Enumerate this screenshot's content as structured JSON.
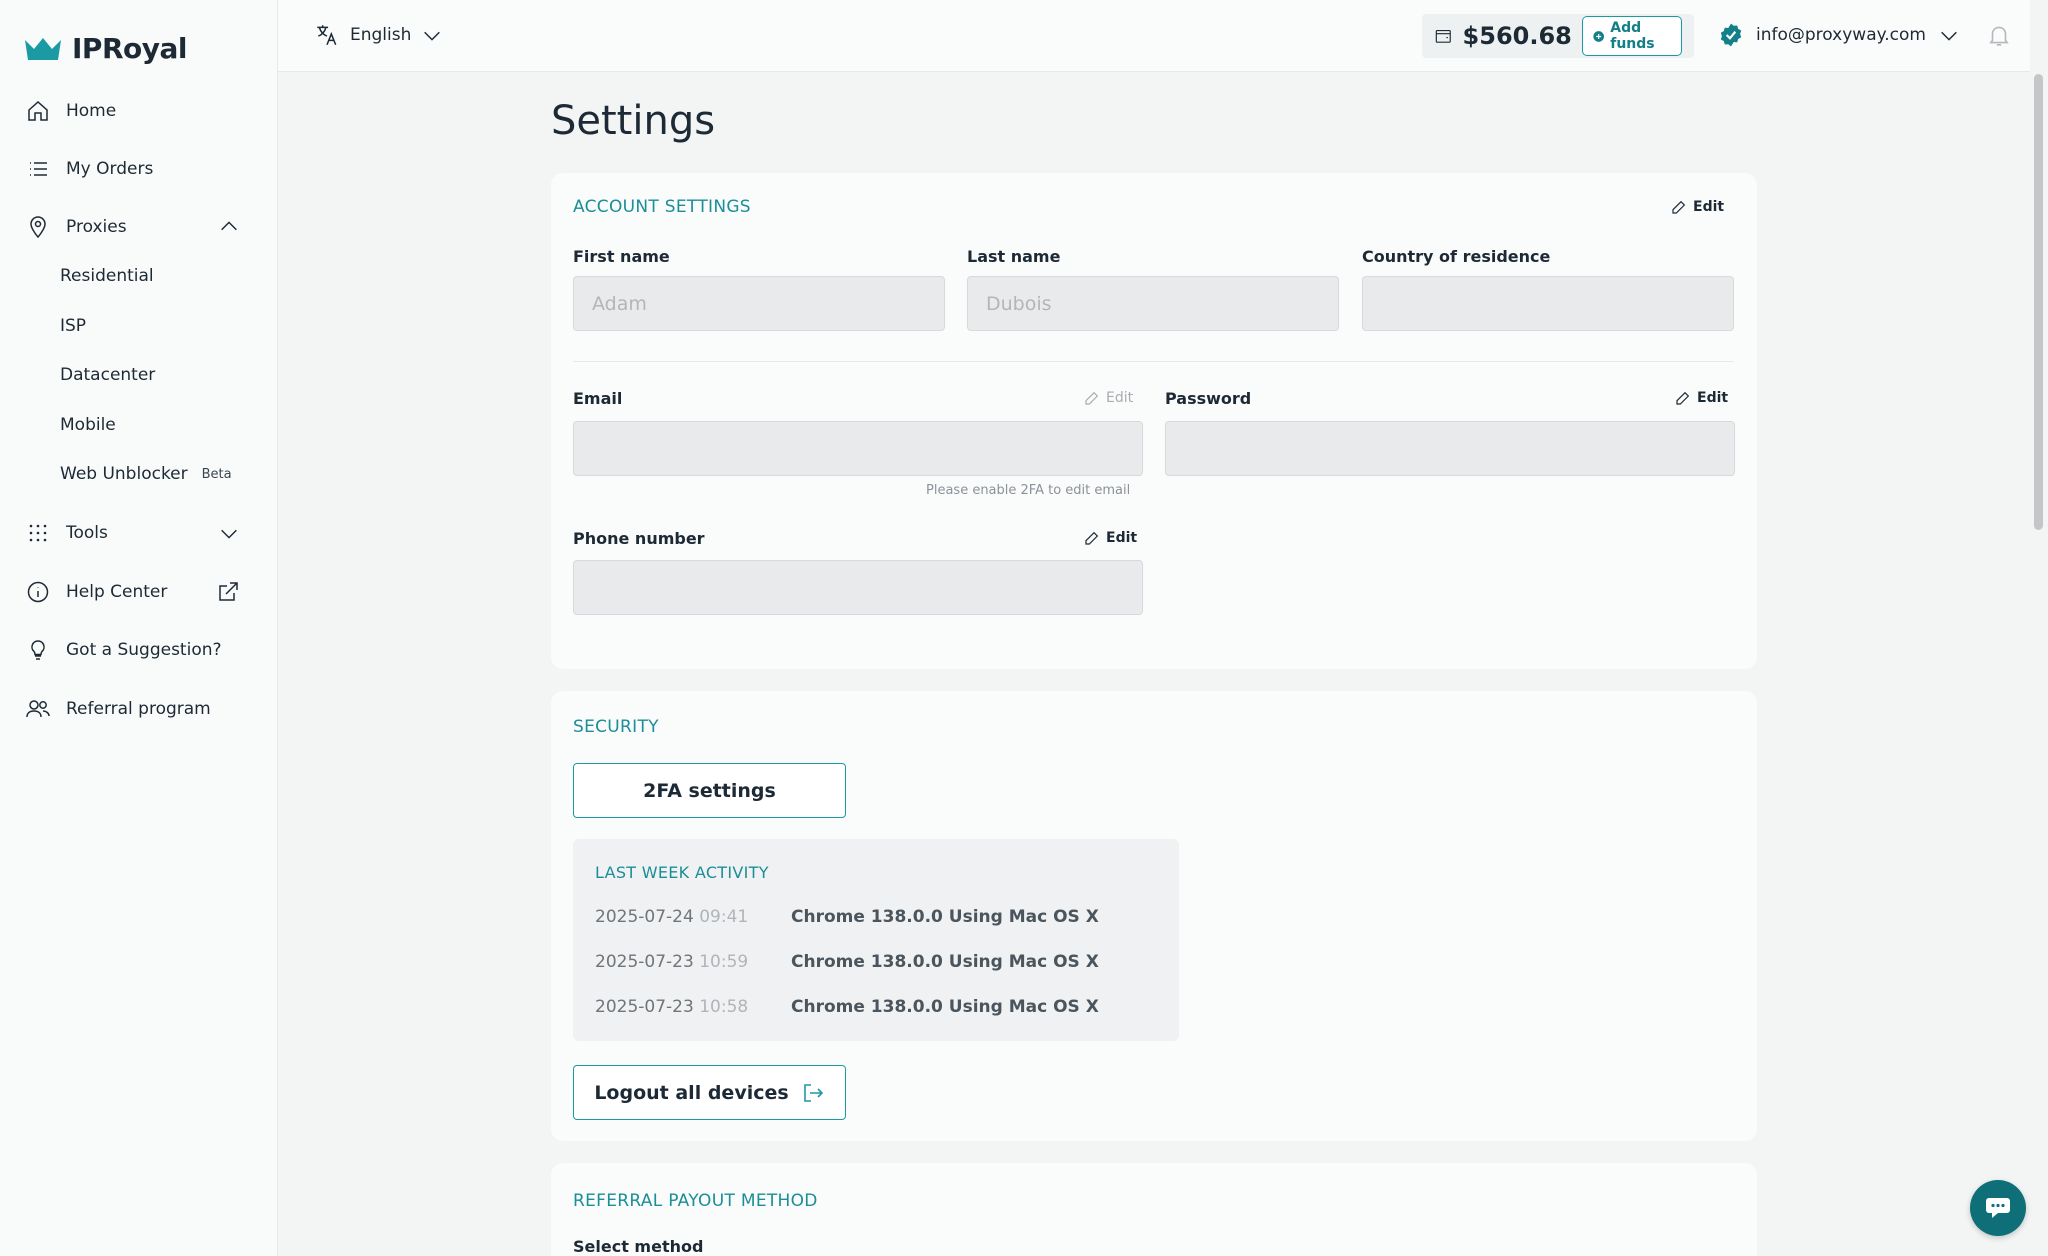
{
  "brand": {
    "name": "IPRoyal",
    "accent": "#1b9aa3"
  },
  "sidebar": {
    "items": [
      {
        "label": "Home",
        "icon": "home-icon"
      },
      {
        "label": "My Orders",
        "icon": "list-icon"
      },
      {
        "label": "Proxies",
        "icon": "location-pin-icon"
      },
      {
        "label": "Tools",
        "icon": "grid-dots-icon"
      },
      {
        "label": "Help Center",
        "icon": "info-icon"
      },
      {
        "label": "Got a Suggestion?",
        "icon": "lightbulb-icon"
      },
      {
        "label": "Referral program",
        "icon": "users-icon"
      }
    ],
    "proxies_sub": [
      {
        "label": "Residential"
      },
      {
        "label": "ISP"
      },
      {
        "label": "Datacenter"
      },
      {
        "label": "Mobile"
      },
      {
        "label": "Web Unblocker",
        "badge": "Beta"
      }
    ]
  },
  "topbar": {
    "language": "English",
    "balance": "$560.68",
    "add_funds": "Add funds",
    "user_email": "info@proxyway.com"
  },
  "page": {
    "title": "Settings"
  },
  "account": {
    "title": "ACCOUNT SETTINGS",
    "edit": "Edit",
    "first_name_label": "First name",
    "first_name_value": "Adam",
    "last_name_label": "Last name",
    "last_name_value": "Dubois",
    "country_label": "Country of residence",
    "country_value": "",
    "email_label": "Email",
    "email_edit": "Edit",
    "email_value": "",
    "email_hint": "Please enable 2FA to edit email",
    "password_label": "Password",
    "password_edit": "Edit",
    "password_value": "",
    "phone_label": "Phone number",
    "phone_edit": "Edit",
    "phone_value": ""
  },
  "security": {
    "title": "SECURITY",
    "twofa_button": "2FA settings",
    "activity_title": "LAST WEEK ACTIVITY",
    "activity": [
      {
        "date": "2025-07-24",
        "time": "09:41",
        "browser": "Chrome 138.0.0 Using Mac OS X"
      },
      {
        "date": "2025-07-23",
        "time": "10:59",
        "browser": "Chrome 138.0.0 Using Mac OS X"
      },
      {
        "date": "2025-07-23",
        "time": "10:58",
        "browser": "Chrome 138.0.0 Using Mac OS X"
      }
    ],
    "logout_button": "Logout all devices"
  },
  "referral": {
    "title": "REFERRAL PAYOUT METHOD",
    "select_label": "Select method"
  }
}
